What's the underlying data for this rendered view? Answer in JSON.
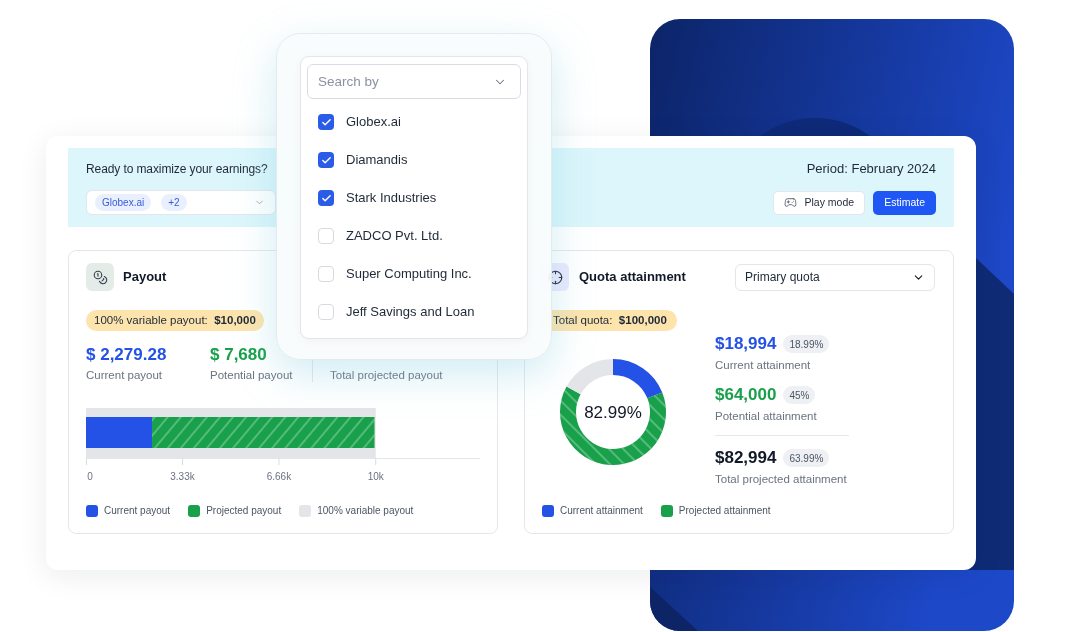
{
  "header": {
    "prompt": "Ready to maximize your earnings?",
    "period": "Period: February 2024",
    "company_filter": {
      "chips": [
        "Globex.ai",
        "+2"
      ]
    },
    "buttons": [
      {
        "label": "Play mode",
        "kind": "secondary"
      },
      {
        "label": "Estimate",
        "kind": "primary"
      }
    ]
  },
  "payout": {
    "title": "Payout",
    "badge": "100% variable payout:  **$10,000**",
    "stats": [
      {
        "value": "$ 2,279.28",
        "label": "Current payout",
        "color": "#2451e6"
      },
      {
        "value": "$ 7,680",
        "label": "Potential payout",
        "color": "#18a04a"
      },
      {
        "label": "Total projected payout"
      }
    ],
    "chart_data": [
      {
        "type": "bar",
        "orientation": "horizontal",
        "stacked": true,
        "categories": [
          null
        ],
        "series": [
          {
            "name": "Current payout",
            "color": "#2451e6",
            "values": [
              2279.28
            ]
          },
          {
            "name": "Projected payout",
            "color": "#18a04a",
            "values": [
              7680
            ]
          }
        ],
        "bands": [
          {
            "axis": "x",
            "from": 0,
            "to": 10000,
            "label": "100% variable payout",
            "color": "#e4e5e8"
          }
        ],
        "xlim": [
          0,
          13600
        ],
        "xticks": [
          {
            "value": 0,
            "label": "0"
          },
          {
            "value": 3330,
            "label": "3.33k"
          },
          {
            "value": 6660,
            "label": "6.66k"
          },
          {
            "value": 10000,
            "label": "10k"
          }
        ],
        "legend": "bottom"
      }
    ]
  },
  "quota": {
    "title": "Quota attainment",
    "select": {
      "value": "Primary quota"
    },
    "badge": "Total quota:  **$100,000**",
    "stats": [
      {
        "value": "$18,994",
        "percent": "18.99%",
        "label": "Current attainment",
        "color": "#2451e6"
      },
      {
        "value": "$64,000",
        "percent": "45%",
        "label": "Potential attainment",
        "color": "#18a04a"
      },
      {
        "value": "$82,994",
        "percent": "63.99%",
        "label": "Total projected attainment",
        "color": "#111827"
      }
    ],
    "chart_data": [
      {
        "type": "donut",
        "categories": [
          "Current attainment",
          "Projected attainment",
          null
        ],
        "values": [
          18.99,
          64,
          17.01
        ],
        "colors": [
          "#2451e6",
          "#18a04a",
          "#e4e5e8"
        ],
        "annotations": [
          "82.99%"
        ]
      }
    ]
  },
  "dropdown": {
    "search": {
      "placeholder": "Search by"
    },
    "items": [
      {
        "label": "Globex.ai",
        "checked": true
      },
      {
        "label": "Diamandis",
        "checked": true
      },
      {
        "label": "Stark Industries",
        "checked": true
      },
      {
        "label": "ZADCO Pvt. Ltd.",
        "checked": false
      },
      {
        "label": "Super Computing Inc.",
        "checked": false
      },
      {
        "label": "Jeff Savings and Loan",
        "checked": false
      }
    ]
  }
}
